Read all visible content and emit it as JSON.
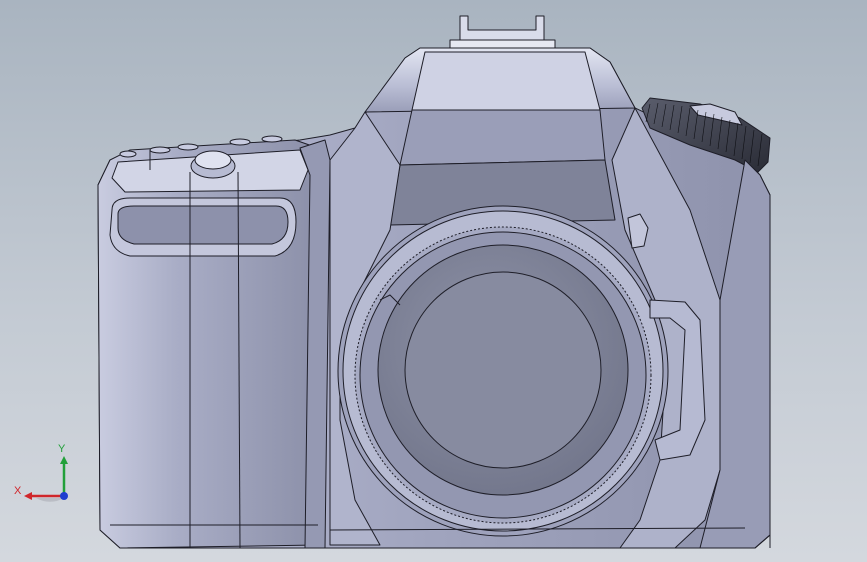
{
  "viewport": {
    "background_top": "#a9b4c0",
    "background_bottom": "#d4d8de",
    "model_fill": "#a4a8c2",
    "edge_color": "#1e1e28"
  },
  "triad": {
    "x_label": "X",
    "y_label": "Y",
    "x_color": "#d0262b",
    "y_color": "#22a03a",
    "z_color": "#1f3fcf"
  }
}
